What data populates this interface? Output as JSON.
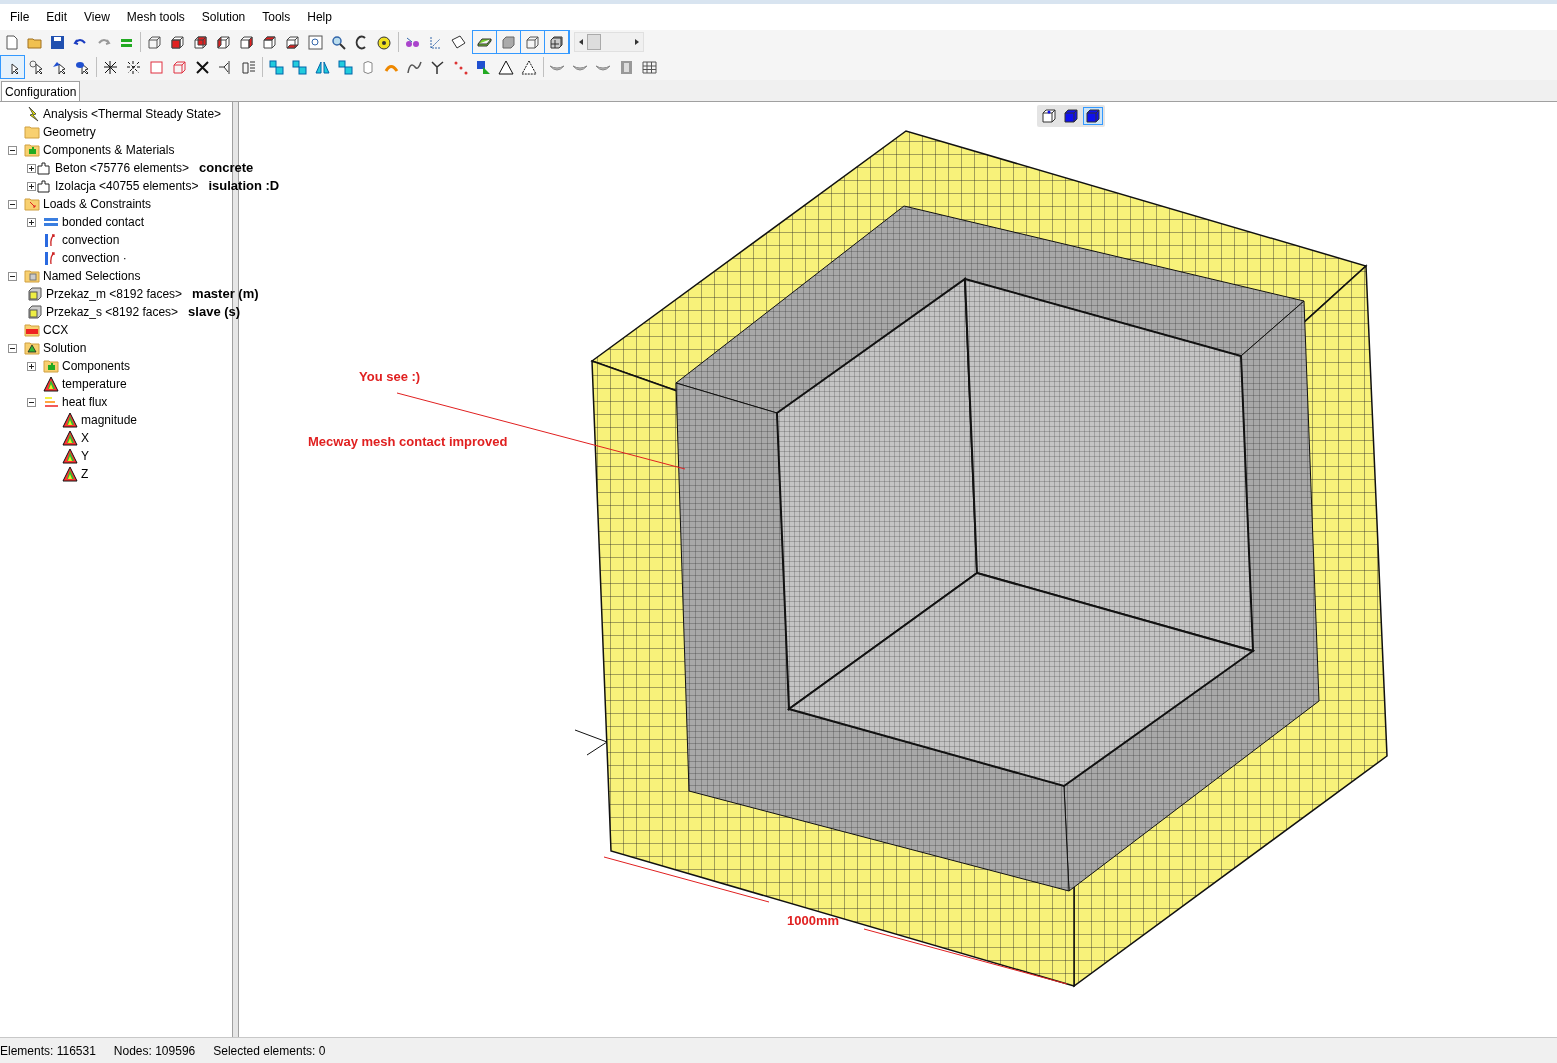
{
  "menu": [
    "File",
    "Edit",
    "View",
    "Mesh tools",
    "Solution",
    "Tools",
    "Help"
  ],
  "panel_tabs": [
    {
      "label": "Configuration",
      "selected": true
    }
  ],
  "tree": [
    {
      "label": "Analysis <Thermal Steady State>",
      "kind": "analysis"
    },
    {
      "label": "Geometry",
      "kind": "folder"
    },
    {
      "label": "Components & Materials",
      "kind": "components",
      "expanded": true,
      "children": [
        {
          "label": "Beton <75776 elements>",
          "kind": "part",
          "expanded": false,
          "note": "concrete"
        },
        {
          "label": "Izolacja <40755 elements>",
          "kind": "part",
          "expanded": false,
          "note": "isulation :D"
        }
      ]
    },
    {
      "label": "Loads & Constraints",
      "kind": "loads",
      "expanded": true,
      "children": [
        {
          "label": "bonded contact",
          "kind": "contact",
          "expanded": false
        },
        {
          "label": "convection",
          "kind": "convection"
        },
        {
          "label": "convection ·",
          "kind": "convection"
        }
      ]
    },
    {
      "label": "Named Selections",
      "kind": "selections",
      "expanded": true,
      "children": [
        {
          "label": "Przekaz_m <8192 faces>",
          "kind": "faces",
          "note": "master (m)"
        },
        {
          "label": "Przekaz_s <8192 faces>",
          "kind": "faces",
          "note": "slave (s)"
        }
      ]
    },
    {
      "label": "CCX",
      "kind": "ccx"
    },
    {
      "label": "Solution",
      "kind": "solution",
      "expanded": true,
      "children": [
        {
          "label": "Components",
          "kind": "components",
          "expanded": false
        },
        {
          "label": "temperature",
          "kind": "result"
        },
        {
          "label": "heat flux",
          "kind": "flux",
          "expanded": true,
          "children": [
            {
              "label": "magnitude",
              "kind": "result"
            },
            {
              "label": "X",
              "kind": "result"
            },
            {
              "label": "Y",
              "kind": "result"
            },
            {
              "label": "Z",
              "kind": "result"
            }
          ]
        }
      ]
    }
  ],
  "view_buttons": [
    {
      "selected": false
    },
    {
      "selected": false
    },
    {
      "selected": true
    }
  ],
  "annotations": [
    {
      "text": "You see :)"
    },
    {
      "text": "Mecway mesh contact improved"
    },
    {
      "text": "1000mm"
    }
  ],
  "status_bar": [
    "Elements: 116531",
    "Nodes: 109596",
    "Selected elements: 0"
  ]
}
